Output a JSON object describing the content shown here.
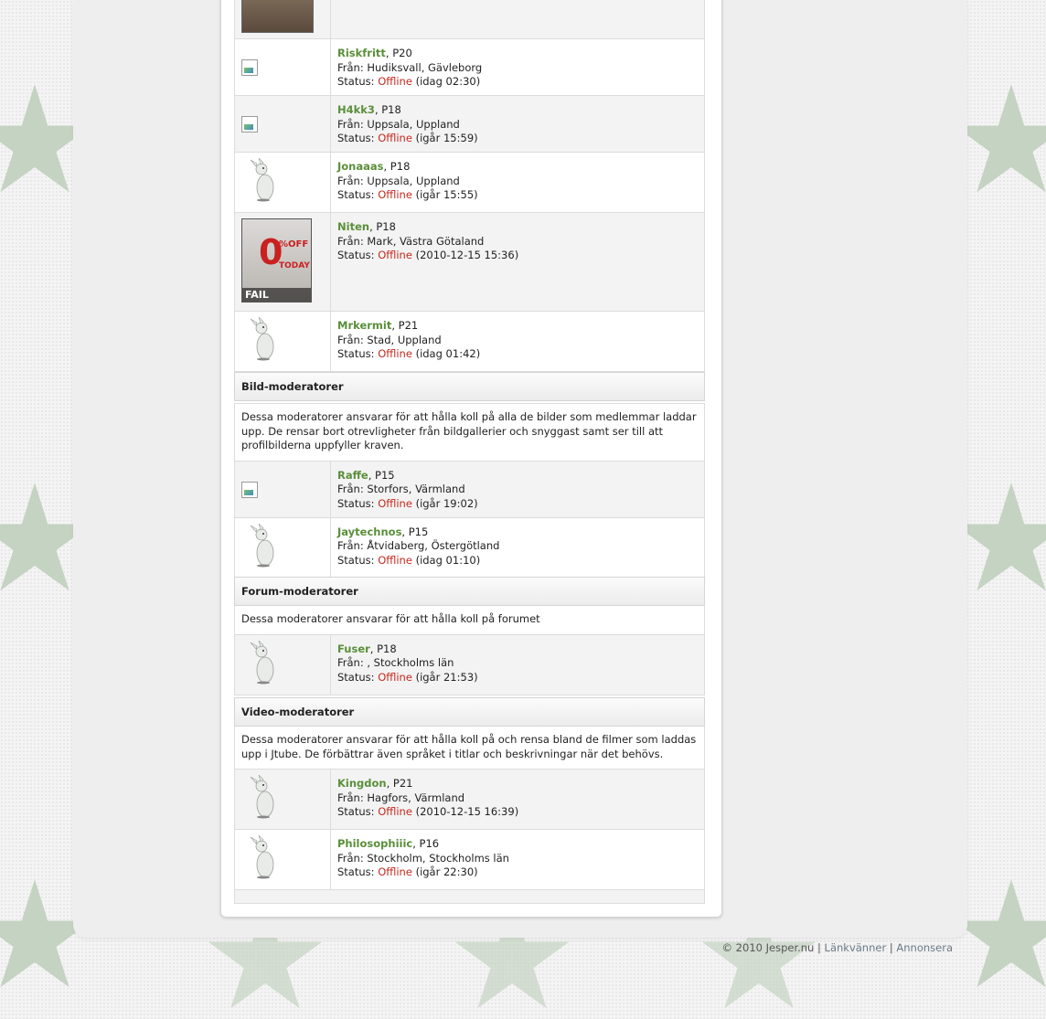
{
  "top_photo_row": {
    "avatar": "user-photo"
  },
  "members_top": [
    {
      "name": "Riskfritt",
      "age": ", P20",
      "from_label": "Från:",
      "from": "Hudiksvall, Gävleborg",
      "status_label": "Status:",
      "status": "Offline",
      "last_seen": "(idag 02:30)",
      "avatar": "broken-image"
    },
    {
      "name": "H4kk3",
      "age": ", P18",
      "from_label": "Från:",
      "from": "Uppsala, Uppland",
      "status_label": "Status:",
      "status": "Offline",
      "last_seen": "(igår 15:59)",
      "avatar": "broken-image"
    },
    {
      "name": "Jonaaas",
      "age": ", P18",
      "from_label": "Från:",
      "from": "Uppsala, Uppland",
      "status_label": "Status:",
      "status": "Offline",
      "last_seen": "(igår 15:55)",
      "avatar": "rabbit"
    },
    {
      "name": "Niten",
      "age": ", P18",
      "from_label": "Från:",
      "from": "Mark, Västra Götaland",
      "status_label": "Status:",
      "status": "Offline",
      "last_seen": "(2010-12-15 15:36)",
      "avatar": "fail-photo"
    },
    {
      "name": "Mrkermit",
      "age": ", P21",
      "from_label": "Från:",
      "from": "Stad, Uppland",
      "status_label": "Status:",
      "status": "Offline",
      "last_seen": "(idag 01:42)",
      "avatar": "rabbit"
    }
  ],
  "fail_photo": {
    "zero": "0",
    "off": "%OFF",
    "today": "TODAY",
    "caption": "FAIL"
  },
  "sections": {
    "bild": {
      "title": "Bild-moderatorer",
      "desc": "Dessa moderatorer ansvarar för att hålla koll på alla de bilder som medlemmar laddar upp. De rensar bort otrevligheter från bildgallerier och snyggast samt ser till att profilbilderna uppfyller kraven.",
      "members": [
        {
          "name": "Raffe",
          "age": ", P15",
          "from_label": "Från:",
          "from": "Storfors, Värmland",
          "status_label": "Status:",
          "status": "Offline",
          "last_seen": "(igår 19:02)",
          "avatar": "broken-image"
        },
        {
          "name": "Jaytechnos",
          "age": ", P15",
          "from_label": "Från:",
          "from": "Åtvidaberg, Östergötland",
          "status_label": "Status:",
          "status": "Offline",
          "last_seen": "(idag 01:10)",
          "avatar": "rabbit"
        }
      ]
    },
    "forum": {
      "title": "Forum-moderatorer",
      "desc": "Dessa moderatorer ansvarar för att hålla koll på forumet",
      "members": [
        {
          "name": "Fuser",
          "age": ", P18",
          "from_label": "Från:",
          "from": ", Stockholms län",
          "status_label": "Status:",
          "status": "Offline",
          "last_seen": "(igår 21:53)",
          "avatar": "rabbit"
        }
      ]
    },
    "video": {
      "title": "Video-moderatorer",
      "desc": "Dessa moderatorer ansvarar för att hålla koll på och rensa bland de filmer som laddas upp i Jtube. De förbättrar även språket i titlar och beskrivningar när det behövs.",
      "members": [
        {
          "name": "Kingdon",
          "age": ", P21",
          "from_label": "Från:",
          "from": "Hagfors, Värmland",
          "status_label": "Status:",
          "status": "Offline",
          "last_seen": "(2010-12-15 16:39)",
          "avatar": "rabbit"
        },
        {
          "name": "Philosophiiic",
          "age": ", P16",
          "from_label": "Från:",
          "from": "Stockholm, Stockholms län",
          "status_label": "Status:",
          "status": "Offline",
          "last_seen": "(igår 22:30)",
          "avatar": "rabbit"
        }
      ]
    }
  },
  "footer": {
    "copyright": "© 2010 Jesper.nu",
    "sep": "|",
    "link_friends": "Länkvänner",
    "link_advertise": "Annonsera"
  },
  "colors": {
    "username": "#5a8f3a",
    "offline": "#c52a1f",
    "star": "#c5d3c2"
  }
}
